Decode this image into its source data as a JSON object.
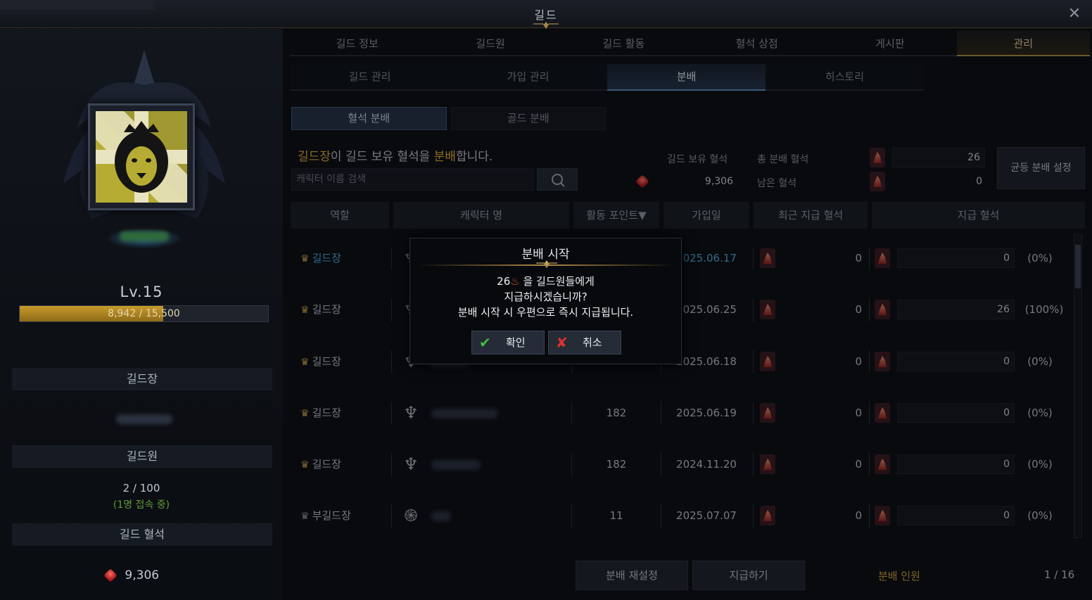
{
  "window": {
    "title": "길드"
  },
  "main_tabs": [
    "길드 정보",
    "길드원",
    "길드 활동",
    "혈석 상점",
    "게시판",
    "관리"
  ],
  "sub_tabs": [
    "길드 관리",
    "가입 관리",
    "분배",
    "히스토리"
  ],
  "third_tabs": [
    "혈석 분배",
    "골드 분배"
  ],
  "guild": {
    "level": "Lv.15",
    "xp": "8,942 / 15,500",
    "xp_fraction": 0.577,
    "leader_label": "길드장",
    "members_label": "길드원",
    "members_count": "2 / 100",
    "online": "(1명 접속 중)",
    "bloodstone_label": "길드 혈석",
    "bloodstone_amount": "9,306"
  },
  "distribution": {
    "desc_part1": "길드장",
    "desc_part2": "이 길드 보유 혈석을 ",
    "desc_part3": "분배",
    "desc_part4": "합니다.",
    "search_placeholder": "캐릭터 이름 검색",
    "guild_stone_label": "길드 보유 혈석",
    "guild_stone_value": "9,306",
    "total_label": "총 분배 혈석",
    "total_value": "26",
    "remain_label": "남은 혈석",
    "remain_value": "0",
    "even_button": "균등 분배 설정"
  },
  "table": {
    "headers": [
      "역할",
      "캐릭터 명",
      "활동 포인트▼",
      "가입일",
      "최근 지급 혈석",
      "지급 혈석"
    ],
    "rows": [
      {
        "role": "길드장",
        "points": "",
        "joined": "2025.06.17",
        "recent": "0",
        "pay": "0",
        "pct": "(0%)"
      },
      {
        "role": "길드장",
        "points": "",
        "joined": "2025.06.25",
        "recent": "0",
        "pay": "26",
        "pct": "(100%)"
      },
      {
        "role": "길드장",
        "points": "",
        "joined": "2025.06.18",
        "recent": "0",
        "pay": "0",
        "pct": "(0%)"
      },
      {
        "role": "길드장",
        "points": "182",
        "joined": "2025.06.19",
        "recent": "0",
        "pay": "0",
        "pct": "(0%)"
      },
      {
        "role": "길드장",
        "points": "182",
        "joined": "2024.11.20",
        "recent": "0",
        "pay": "0",
        "pct": "(0%)"
      },
      {
        "role": "부길드장",
        "points": "11",
        "joined": "2025.07.07",
        "recent": "0",
        "pay": "0",
        "pct": "(0%)"
      }
    ]
  },
  "footer": {
    "reset_button": "분배 재설정",
    "pay_button": "지급하기",
    "dist_label": "분배 인원",
    "page": "1 / 16"
  },
  "modal": {
    "title": "분배 시작",
    "line1_num": "26",
    "line1_rest": " 을 길드원들에게",
    "line2": "지급하시겠습니까?",
    "line3": "분배 시작 시 우편으로 즉시 지급됩니다.",
    "confirm": "확인",
    "cancel": "취소"
  },
  "colors": {
    "accent_gold": "#c69a36",
    "active_tab_blue": "#5a86b8",
    "confirm_green": "#3fbf3f",
    "cancel_red": "#e03030"
  }
}
